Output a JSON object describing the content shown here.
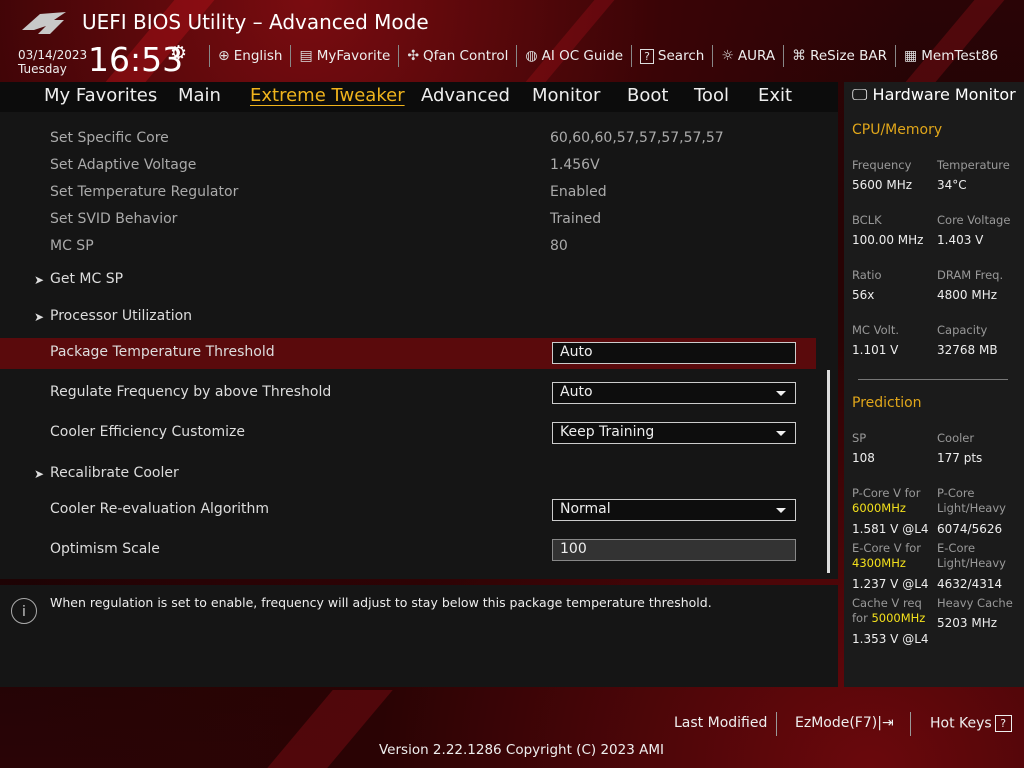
{
  "app": {
    "title": "UEFI BIOS Utility – Advanced Mode"
  },
  "clock": {
    "date": "03/14/2023",
    "day": "Tuesday",
    "time": "16:53"
  },
  "topbar": [
    {
      "icon": "globe-icon",
      "glyph": "⊕",
      "label": "English"
    },
    {
      "icon": "favorite-icon",
      "glyph": "▤",
      "label": "MyFavorite"
    },
    {
      "icon": "fan-icon",
      "glyph": "✣",
      "label": "Qfan Control"
    },
    {
      "icon": "ai-icon",
      "glyph": "◍",
      "label": "AI OC Guide"
    },
    {
      "icon": "search-icon",
      "glyph": "?",
      "label": "Search"
    },
    {
      "icon": "aura-icon",
      "glyph": "☼",
      "label": "AURA"
    },
    {
      "icon": "resize-bar-icon",
      "glyph": "⌘",
      "label": "ReSize BAR"
    },
    {
      "icon": "memtest-icon",
      "glyph": "▦",
      "label": "MemTest86"
    }
  ],
  "tabs": [
    "My Favorites",
    "Main",
    "Extreme Tweaker",
    "Advanced",
    "Monitor",
    "Boot",
    "Tool",
    "Exit"
  ],
  "active_tab": "Extreme Tweaker",
  "settings": {
    "set_specific_core": {
      "label": "Set Specific Core",
      "value": "60,60,60,57,57,57,57,57"
    },
    "set_adaptive_voltage": {
      "label": "Set Adaptive Voltage",
      "value": "1.456V"
    },
    "set_temp_regulator": {
      "label": "Set Temperature Regulator",
      "value": "Enabled"
    },
    "set_svid_behavior": {
      "label": "Set SVID Behavior",
      "value": "Trained"
    },
    "mc_sp": {
      "label": "MC SP",
      "value": "80"
    },
    "get_mc_sp": {
      "label": "Get MC SP"
    },
    "processor_utilization": {
      "label": "Processor Utilization"
    },
    "pkg_temp_threshold": {
      "label": "Package Temperature Threshold",
      "value": "Auto"
    },
    "regulate_frequency": {
      "label": "Regulate Frequency by above Threshold",
      "value": "Auto"
    },
    "cooler_efficiency": {
      "label": "Cooler Efficiency Customize",
      "value": "Keep Training"
    },
    "recalibrate_cooler": {
      "label": "Recalibrate Cooler"
    },
    "cooler_reeval": {
      "label": "Cooler Re-evaluation Algorithm",
      "value": "Normal"
    },
    "optimism_scale": {
      "label": "Optimism Scale",
      "value": "100"
    }
  },
  "help": {
    "text": "When regulation is set to enable, frequency will adjust to stay below this package temperature threshold."
  },
  "hw_monitor": {
    "title": "Hardware Monitor",
    "cpu_memory": {
      "heading": "CPU/Memory",
      "frequency": {
        "label": "Frequency",
        "value": "5600 MHz"
      },
      "temperature": {
        "label": "Temperature",
        "value": "34°C"
      },
      "bclk": {
        "label": "BCLK",
        "value": "100.00 MHz"
      },
      "core_voltage": {
        "label": "Core Voltage",
        "value": "1.403 V"
      },
      "ratio": {
        "label": "Ratio",
        "value": "56x"
      },
      "dram_freq": {
        "label": "DRAM Freq.",
        "value": "4800 MHz"
      },
      "mc_volt": {
        "label": "MC Volt.",
        "value": "1.101 V"
      },
      "capacity": {
        "label": "Capacity",
        "value": "32768 MB"
      }
    },
    "prediction": {
      "heading": "Prediction",
      "sp": {
        "label": "SP",
        "value": "108"
      },
      "cooler": {
        "label": "Cooler",
        "value": "177 pts"
      },
      "pcore_v": {
        "label": "P-Core V for",
        "freq": "6000MHz",
        "value": "1.581 V @L4"
      },
      "pcore_lh": {
        "label1": "P-Core",
        "label2": "Light/Heavy",
        "value": "6074/5626"
      },
      "ecore_v": {
        "label": "E-Core V for",
        "freq": "4300MHz",
        "value": "1.237 V @L4"
      },
      "ecore_lh": {
        "label1": "E-Core",
        "label2": "Light/Heavy",
        "value": "4632/4314"
      },
      "cache_v": {
        "label": "Cache V req",
        "label_for": "for",
        "freq": "5000MHz",
        "value": "1.353 V @L4"
      },
      "heavy_cache": {
        "label": "Heavy Cache",
        "value": "5203 MHz"
      }
    }
  },
  "footer": {
    "last_modified": "Last Modified",
    "ezmode": "EzMode(F7)",
    "hotkeys": "Hot Keys",
    "version": "Version 2.22.1286 Copyright (C) 2023 AMI"
  }
}
